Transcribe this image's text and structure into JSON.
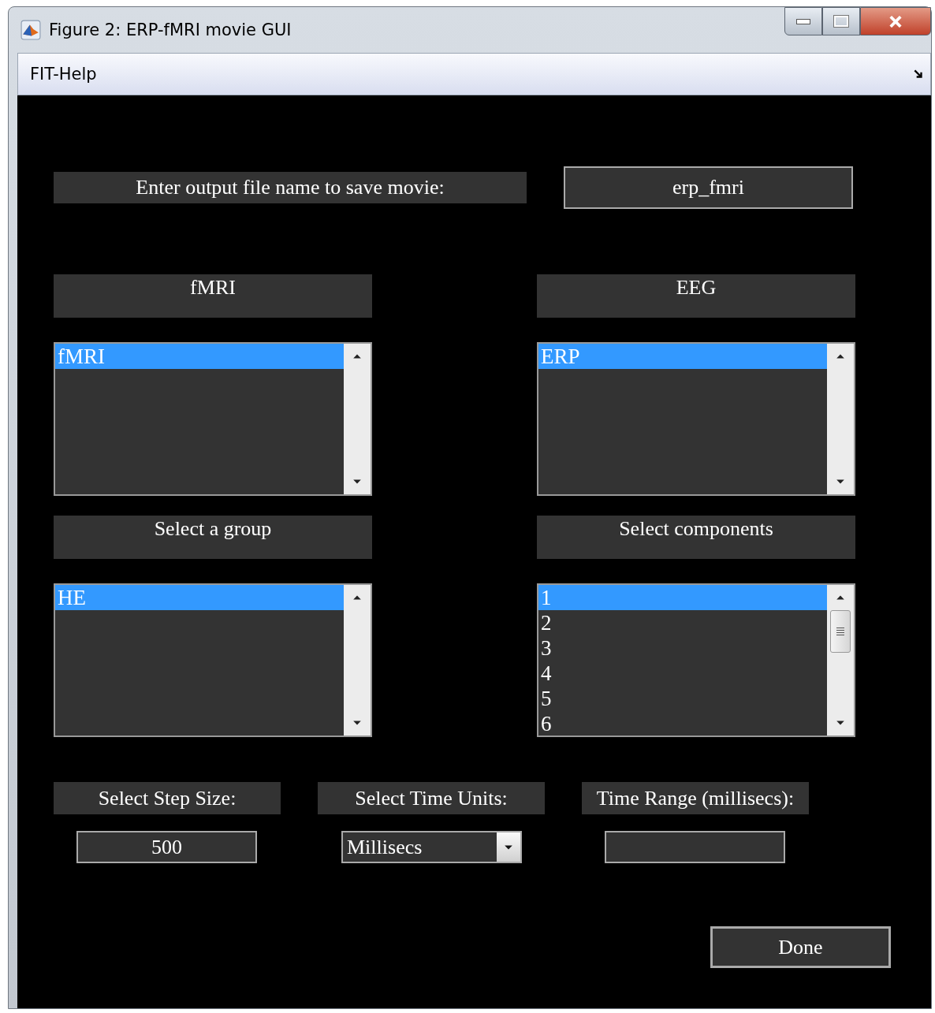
{
  "window": {
    "title": "Figure 2: ERP-fMRI movie GUI"
  },
  "menu": [
    {
      "label": "FIT-Help"
    }
  ],
  "output": {
    "label": "Enter output file name to save movie:",
    "value": "erp_fmri"
  },
  "panels": [
    {
      "heading": "fMRI",
      "items": [
        {
          "label": "fMRI",
          "selected": true
        }
      ]
    },
    {
      "heading": "EEG",
      "items": [
        {
          "label": "ERP",
          "selected": true
        }
      ]
    },
    {
      "heading": "Select a group",
      "items": [
        {
          "label": "HE",
          "selected": true
        }
      ]
    },
    {
      "heading": "Select components",
      "items": [
        {
          "label": "1",
          "selected": true
        },
        {
          "label": "2",
          "selected": false
        },
        {
          "label": "3",
          "selected": false
        },
        {
          "label": "4",
          "selected": false
        },
        {
          "label": "5",
          "selected": false
        },
        {
          "label": "6",
          "selected": false
        }
      ]
    }
  ],
  "settings": [
    {
      "label": "Select Step Size:",
      "kind": "field",
      "value": "500"
    },
    {
      "label": "Select Time Units:",
      "kind": "dropdown",
      "value": "Millisecs"
    },
    {
      "label": "Time Range (millisecs):",
      "kind": "field"
    }
  ],
  "done_button": "Done"
}
